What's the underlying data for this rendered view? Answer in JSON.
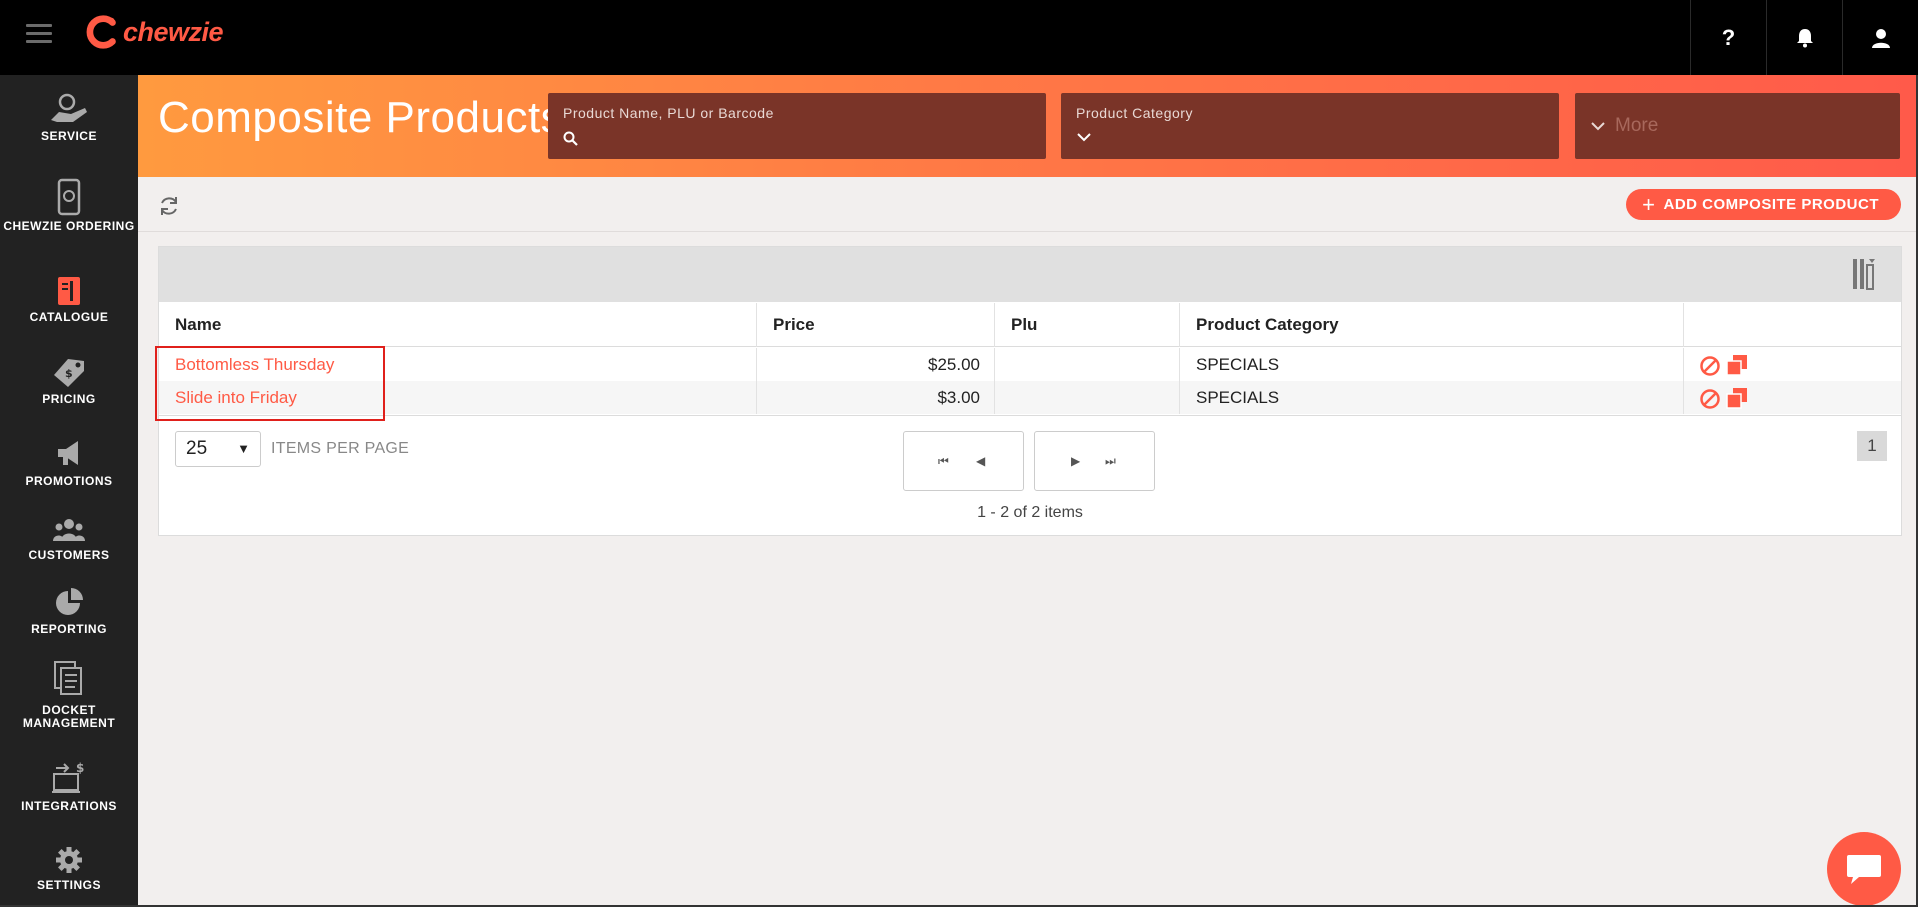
{
  "brand": {
    "name": "chewzie",
    "accent": "#ff5a45"
  },
  "topbar": {
    "help_label": "?",
    "icons": [
      "menu-icon",
      "help-icon",
      "bell-icon",
      "user-icon"
    ]
  },
  "sidebar": {
    "items": [
      {
        "label": "SERVICE",
        "icon": "service-icon"
      },
      {
        "label": "CHEWZIE ORDERING",
        "icon": "phone-ordering-icon"
      },
      {
        "label": "CATALOGUE",
        "icon": "catalogue-icon"
      },
      {
        "label": "PRICING",
        "icon": "price-tag-icon"
      },
      {
        "label": "PROMOTIONS",
        "icon": "megaphone-icon"
      },
      {
        "label": "CUSTOMERS",
        "icon": "customers-icon"
      },
      {
        "label": "REPORTING",
        "icon": "pie-chart-icon"
      },
      {
        "label": "DOCKET MANAGEMENT",
        "icon": "docket-icon"
      },
      {
        "label": "INTEGRATIONS",
        "icon": "integrations-icon"
      },
      {
        "label": "SETTINGS",
        "icon": "gear-icon"
      }
    ]
  },
  "header": {
    "title": "Composite Products",
    "search_label": "Product Name, PLU or Barcode",
    "category_label": "Product Category",
    "more_label": "More"
  },
  "toolbar": {
    "add_label": "ADD COMPOSITE PRODUCT"
  },
  "table": {
    "columns": [
      "Name",
      "Price",
      "Plu",
      "Product Category"
    ],
    "rows": [
      {
        "name": "Bottomless Thursday",
        "price": "$25.00",
        "plu": "",
        "category": "SPECIALS"
      },
      {
        "name": "Slide into Friday",
        "price": "$3.00",
        "plu": "",
        "category": "SPECIALS"
      }
    ]
  },
  "pager": {
    "per_page": "25",
    "per_page_label": "ITEMS PER PAGE",
    "info": "1 - 2 of 2 items",
    "page": "1"
  }
}
